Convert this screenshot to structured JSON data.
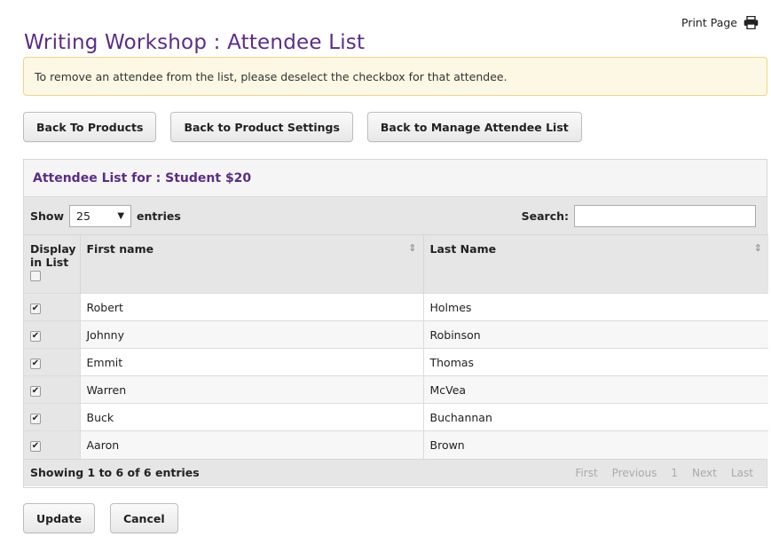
{
  "header": {
    "title": "Writing Workshop : Attendee List",
    "print_label": "Print Page",
    "print_icon": "printer-icon"
  },
  "notice": {
    "text": "To remove an attendee from the list, please deselect the checkbox for that attendee."
  },
  "nav_buttons": {
    "back_products": "Back To Products",
    "back_settings": "Back to Product Settings",
    "back_manage": "Back to Manage Attendee List"
  },
  "panel": {
    "title": "Attendee List for : Student $20"
  },
  "controls": {
    "show_label": "Show",
    "entries_value": "25",
    "entries_label": "entries",
    "search_label": "Search:",
    "search_value": ""
  },
  "table": {
    "columns": [
      "Display in List",
      "First name",
      "Last Name"
    ],
    "rows": [
      {
        "checked": true,
        "first": "Robert",
        "last": "Holmes"
      },
      {
        "checked": true,
        "first": "Johnny",
        "last": "Robinson"
      },
      {
        "checked": true,
        "first": "Emmit",
        "last": "Thomas"
      },
      {
        "checked": true,
        "first": "Warren",
        "last": "McVea"
      },
      {
        "checked": true,
        "first": "Buck",
        "last": "Buchannan"
      },
      {
        "checked": true,
        "first": "Aaron",
        "last": "Brown"
      }
    ]
  },
  "footer": {
    "info": "Showing 1 to 6 of 6 entries",
    "pager": [
      "First",
      "Previous",
      "1",
      "Next",
      "Last"
    ]
  },
  "actions": {
    "update": "Update",
    "cancel": "Cancel"
  },
  "colors": {
    "title": "#5b2d86",
    "notice_bg": "#fcf8e3",
    "notice_border": "#f0d48a"
  }
}
